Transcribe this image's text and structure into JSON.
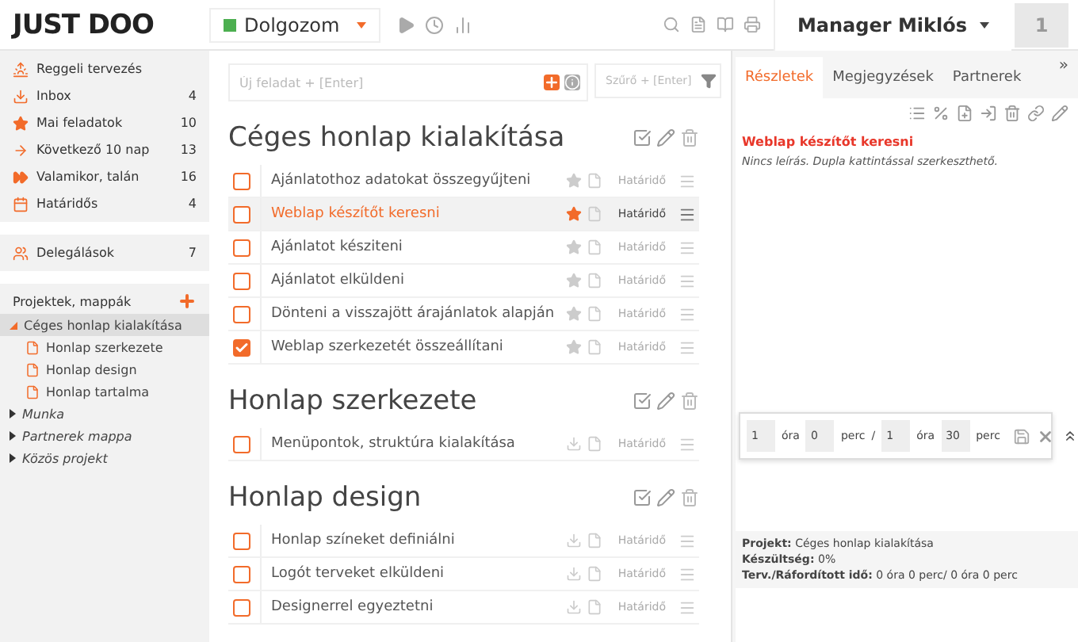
{
  "header": {
    "logo": "JUST DOO",
    "status": {
      "label": "Dolgozom",
      "color": "#4caf50"
    },
    "user": "Manager Miklós",
    "badge": "1"
  },
  "sidebar": {
    "items": [
      {
        "label": "Reggeli tervezés"
      },
      {
        "label": "Inbox",
        "count": "4"
      },
      {
        "label": "Mai feladatok",
        "count": "10"
      },
      {
        "label": "Következő 10 nap",
        "count": "13"
      },
      {
        "label": "Valamikor, talán",
        "count": "16"
      },
      {
        "label": "Határidős",
        "count": "4"
      },
      {
        "label": "Delegálások",
        "count": "7"
      }
    ],
    "projects_title": "Projektek, mappák",
    "tree": [
      {
        "label": "Céges honlap kialakítása",
        "expanded": true,
        "selected": true,
        "italic": false,
        "children": [
          {
            "label": "Honlap szerkezete"
          },
          {
            "label": "Honlap design"
          },
          {
            "label": "Honlap tartalma"
          }
        ]
      },
      {
        "label": "Munka",
        "expanded": false,
        "selected": false,
        "italic": true
      },
      {
        "label": "Partnerek mappa",
        "expanded": false,
        "selected": false,
        "italic": true
      },
      {
        "label": "Közös projekt",
        "expanded": false,
        "selected": false,
        "italic": true
      }
    ]
  },
  "main": {
    "new_task": {
      "placeholder": "Új feladat + [Enter]"
    },
    "filter": {
      "placeholder": "Szűrő + [Enter]"
    },
    "sections": [
      {
        "title": "Céges honlap kialakítása",
        "tasks": [
          {
            "text": "Ajánlatothoz adatokat összegyűjteni",
            "kind": "star",
            "checked": false,
            "selected": false,
            "deadline": "Határidő"
          },
          {
            "text": "Weblap készítőt keresni",
            "kind": "star",
            "checked": false,
            "selected": true,
            "deadline": "Határidő"
          },
          {
            "text": "Ajánlatot késziteni",
            "kind": "star",
            "checked": false,
            "selected": false,
            "deadline": "Határidő"
          },
          {
            "text": "Ajánlatot elküldeni",
            "kind": "star",
            "checked": false,
            "selected": false,
            "deadline": "Határidő"
          },
          {
            "text": "Dönteni a visszajött árajánlatok alapján",
            "kind": "star",
            "checked": false,
            "selected": false,
            "deadline": "Határidő"
          },
          {
            "text": "Weblap szerkezetét összeállítani",
            "kind": "star",
            "checked": true,
            "selected": false,
            "deadline": "Határidő"
          }
        ]
      },
      {
        "title": "Honlap szerkezete",
        "tasks": [
          {
            "text": "Menüpontok, struktúra kialakítása",
            "kind": "inbox",
            "checked": false,
            "selected": false,
            "deadline": "Határidő"
          }
        ]
      },
      {
        "title": "Honlap design",
        "tasks": [
          {
            "text": "Honlap színeket definiálni",
            "kind": "inbox",
            "checked": false,
            "selected": false,
            "deadline": "Határidő"
          },
          {
            "text": "Logót terveket elküldeni",
            "kind": "inbox",
            "checked": false,
            "selected": false,
            "deadline": "Határidő"
          },
          {
            "text": "Designerrel egyeztetni",
            "kind": "inbox",
            "checked": false,
            "selected": false,
            "deadline": "Határidő"
          }
        ]
      }
    ]
  },
  "detail": {
    "tabs": [
      {
        "label": "Részletek",
        "selected": true
      },
      {
        "label": "Megjegyzések",
        "selected": false
      },
      {
        "label": "Partnerek",
        "selected": false
      }
    ],
    "expand": "»",
    "title": "Weblap készítőt keresni",
    "description": "Nincs leírás. Dupla kattintással szerkeszthető.",
    "info": [
      {
        "label": "Projekt:",
        "value": "Céges honlap kialakítása"
      },
      {
        "label": "Készültség:",
        "value": "0%"
      },
      {
        "label": "Terv./Ráfordított idő:",
        "value": "0 óra 0 perc/ 0 óra 0 perc"
      }
    ],
    "time": {
      "plan_hours": "1",
      "hours_unit": "óra",
      "plan_minutes": "0",
      "minutes_unit": "perc",
      "separator": "/",
      "spent_hours": "1",
      "spent_hours_unit": "óra",
      "spent_minutes": "30",
      "spent_minutes_unit": "perc"
    }
  }
}
